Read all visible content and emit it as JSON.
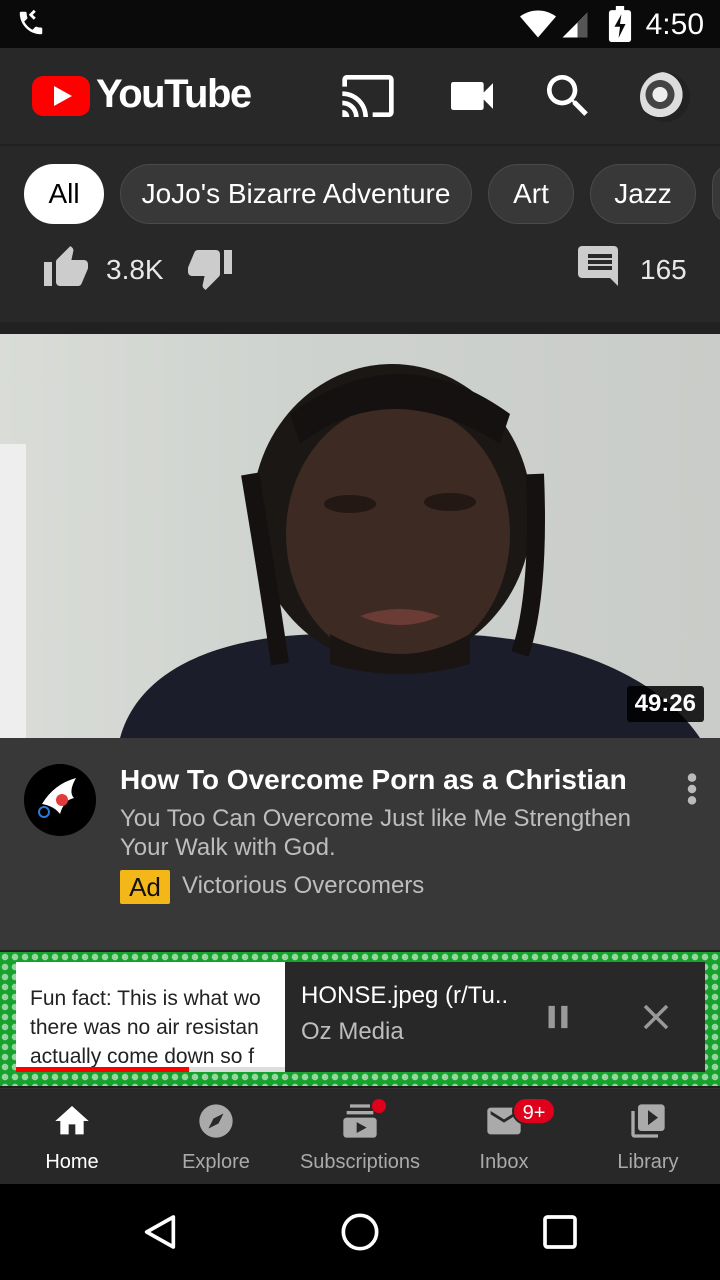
{
  "status_bar": {
    "time": "4:50"
  },
  "header": {
    "logo_text": "YouTube"
  },
  "chips": [
    {
      "label": "All",
      "active": true
    },
    {
      "label": "JoJo's Bizarre Adventure",
      "active": false
    },
    {
      "label": "Art",
      "active": false
    },
    {
      "label": "Jazz",
      "active": false
    }
  ],
  "previous_item_actions": {
    "likes": "3.8K",
    "comments": "165"
  },
  "ad_card": {
    "duration": "49:26",
    "title": "How To Overcome Porn as a Christian",
    "description": "You Too Can Overcome Just like Me Strengthen Your Walk with God.",
    "badge": "Ad",
    "advertiser": "Victorious Overcomers"
  },
  "miniplayer": {
    "thumb_text": "Fun fact: This is what wo\nthere was no air resistan\nactually come down so f",
    "title": "HONSE.jpeg (r/Tu..",
    "channel": "Oz Media",
    "progress": 0.64
  },
  "bottom_nav": [
    {
      "label": "Home",
      "icon": "home-icon",
      "active": true
    },
    {
      "label": "Explore",
      "icon": "compass-icon",
      "active": false
    },
    {
      "label": "Subscriptions",
      "icon": "subscriptions-icon",
      "active": false
    },
    {
      "label": "Inbox",
      "icon": "mail-icon",
      "active": false,
      "badge": "9+"
    },
    {
      "label": "Library",
      "icon": "library-icon",
      "active": false
    }
  ],
  "colors": {
    "accent": "#ff0000",
    "ad_badge": "#f3b71a",
    "notification": "#e0001b"
  }
}
